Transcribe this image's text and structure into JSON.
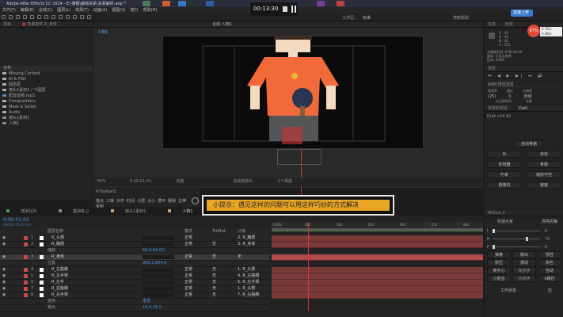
{
  "window": {
    "title": "Adobe After Effects CC 2014 - E:\\课程\\解锁关系\\关系解析.aep *"
  },
  "menu": [
    "文件(F)",
    "编辑(E)",
    "合成(C)",
    "图层(L)",
    "效果(T)",
    "动画(A)",
    "视图(V)",
    "窗口",
    "帮助(H)"
  ],
  "toolbar": {
    "workspace_label": "工作区:",
    "workspace_value": "标准",
    "search_label": "搜索帮助"
  },
  "video_player": {
    "time": "00:13:30",
    "stop_icon": "stop-icon",
    "pause_icon": "pause-icon",
    "badge": "加速上传"
  },
  "project": {
    "tab": "项目",
    "effects_tab": "效果控件 R_身体",
    "columns": {
      "name": "名称"
    },
    "items": [
      {
        "name": "Missing Content",
        "type": "folder"
      },
      {
        "name": "AI & PSD",
        "type": "folder"
      },
      {
        "name": "固态层",
        "type": "folder"
      },
      {
        "name": "镜头1素材1 / 个图层",
        "type": "folder"
      },
      {
        "name": "配音音频.mp3",
        "type": "audio"
      },
      {
        "name": "Compositions",
        "type": "folder"
      },
      {
        "name": "Mask & Solids",
        "type": "folder"
      },
      {
        "name": "Audio",
        "type": "folder"
      },
      {
        "name": "镜头1素材1",
        "type": "comp"
      },
      {
        "name": "人物1",
        "type": "comp"
      }
    ]
  },
  "viewer": {
    "tab": "合成 人物1",
    "comp_label": "人物1",
    "zoom": "50%",
    "timecode": "0:00:01:03",
    "quality": "完整",
    "camera": "活动摄像机",
    "views": "1个视图"
  },
  "toolbar2": {
    "title": "R-Toolbar2",
    "buttons": [
      "锚点",
      "三维",
      "对齐",
      "时间",
      "分层",
      "大小",
      "循环",
      "删除",
      "拉伸",
      "复制"
    ]
  },
  "tip": {
    "text": "小提示：遇见这样的问题可以用这样巧妙的方式解决"
  },
  "timeline": {
    "tabs": [
      "渲染队列",
      "基础练习",
      "镜头1素材1",
      "人物1",
      "镜头1素材1"
    ],
    "active_tab": "人物1",
    "timecode": "0:00:01:03",
    "fps": "00028 (25.00 fps)",
    "columns": {
      "name": "图层名称",
      "mode": "模式",
      "trkmat": "TrkMat",
      "parent": "父级"
    },
    "ruler": [
      "0:00s",
      "01s",
      "02s",
      "03s",
      "04s",
      "05s",
      "06s"
    ],
    "layers": [
      {
        "num": "1",
        "name": "R_头部",
        "mode": "正常",
        "trk": "",
        "parent": "2. R_胸部"
      },
      {
        "num": "2",
        "name": "R_胸部",
        "mode": "正常",
        "trk": "无",
        "parent": "3. R_身体"
      },
      {
        "sub": "缩放",
        "value": "64.0,64.0%"
      },
      {
        "num": "3",
        "name": "R_身体",
        "mode": "正常",
        "trk": "无",
        "parent": "无",
        "selected": true
      },
      {
        "sub": "位置",
        "value": "966.2,864.8"
      },
      {
        "num": "4",
        "name": "R_左胳膊",
        "mode": "正常",
        "trk": "无",
        "parent": "1. R_头部"
      },
      {
        "num": "5",
        "name": "R_左手臂",
        "mode": "正常",
        "trk": "无",
        "parent": "4. R_左胳膊"
      },
      {
        "num": "6",
        "name": "R_左手",
        "mode": "正常",
        "trk": "无",
        "parent": "5. R_左手臂"
      },
      {
        "num": "7",
        "name": "R_右胳膊",
        "mode": "正常",
        "trk": "无",
        "parent": "1. R_头部"
      },
      {
        "num": "8",
        "name": "R_右手臂",
        "mode": "正常",
        "trk": "无",
        "parent": "7. R_右胳膊"
      },
      {
        "sub": "变换",
        "value": "重置"
      },
      {
        "sub": "锚点",
        "value": "18.0,18.0"
      }
    ]
  },
  "info": {
    "tab": "信息",
    "audio_tab": "音频",
    "r": "R : 40",
    "g": "G : 40",
    "b": "B : 40",
    "a": "A : 255",
    "lines": [
      "关键帧时间: 0:00:00:20",
      "缓动: 只显示选择",
      "区间: 0.000"
    ],
    "cpu": "67%",
    "net_up": "0.7K/s",
    "net_down": "0.4K/s"
  },
  "preview": {
    "tab": "预览",
    "ram": "RAM 预览选项",
    "fps_label": "帧速率",
    "skip_label": "跳过",
    "res_label": "分辨率",
    "fps": "(25)",
    "skip": "0",
    "res": "自动",
    "from_current": "从当前时间",
    "fullscreen": "全屏"
  },
  "duik": {
    "tabs": [
      "效果和预设",
      "Duik"
    ],
    "version": "Duik v14.42",
    "buttons": [
      "自动骨骼",
      "IK",
      "目标",
      "控制器",
      "骨骼",
      "约束",
      "缩放可控",
      "摄像机",
      "链接"
    ]
  },
  "motion": {
    "tab": "Motion 2",
    "preset": "欢迎大家",
    "preset2": "漂亮风格",
    "sliders": [
      {
        "label": "I",
        "value": 0
      },
      {
        "label": "H",
        "value": 70
      },
      {
        "label": "F",
        "value": 0
      }
    ],
    "buttons": [
      "弹簧",
      "跳出",
      "惯性",
      "挤压",
      "振动",
      "命名",
      "到中心",
      "大爪子",
      "自动",
      "小爬虫",
      "小爪子",
      "k路径"
    ],
    "bottom": "工作状态",
    "bottom_btn": "应"
  },
  "colors": {
    "accent": "#e8a625",
    "layer_bar": "#7a3a3a",
    "label_red": "#c94a4a",
    "cti": "#d33"
  }
}
